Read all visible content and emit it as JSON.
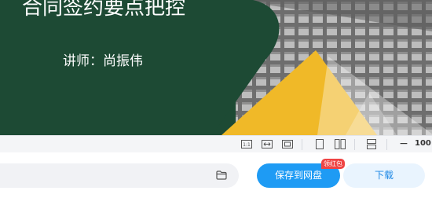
{
  "slide": {
    "title": "合同签约要点把控",
    "lecturer": "讲师：尚振伟"
  },
  "toolbar": {
    "icons": [
      "actual-size-icon",
      "fit-width-icon",
      "fit-page-icon",
      "single-page-icon",
      "double-page-icon",
      "scroll-mode-icon"
    ],
    "zoom_out": "−",
    "zoom_level": "100"
  },
  "bottom": {
    "save_label": "保存到网盘",
    "badge_label": "领红包",
    "download_label": "下载"
  },
  "colors": {
    "slide_green": "#1d4a34",
    "slide_yellow": "#f0b928",
    "primary_blue": "#1e9bf4",
    "badge_red": "#ef4444"
  }
}
